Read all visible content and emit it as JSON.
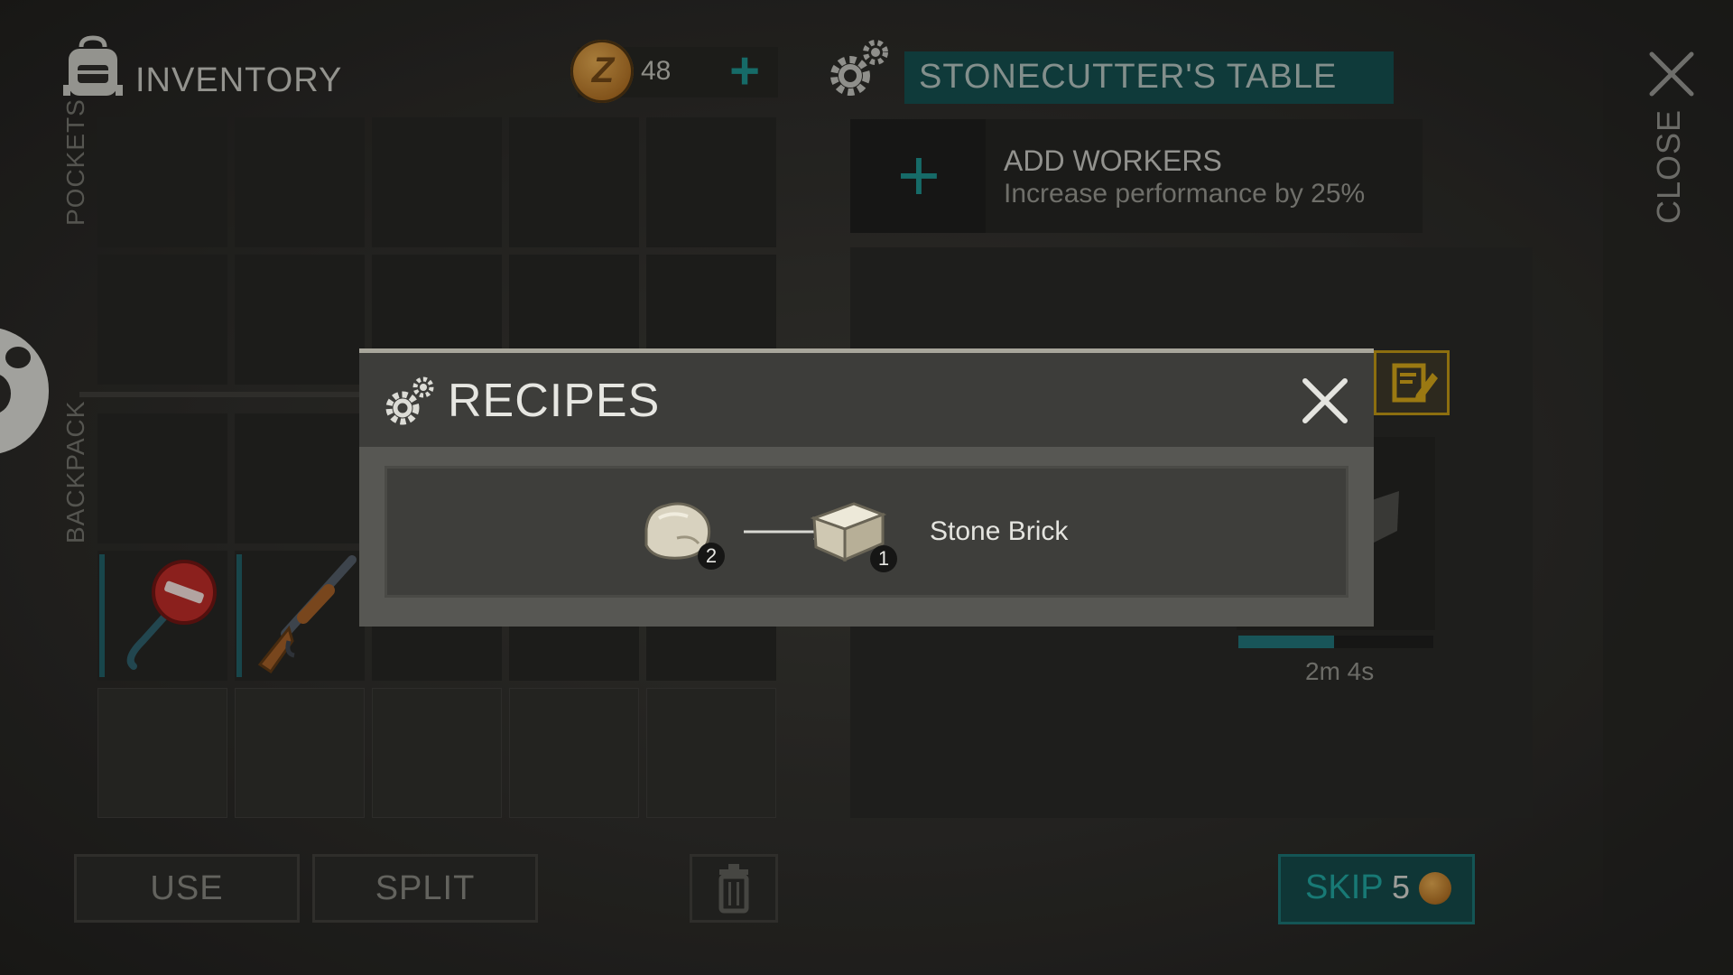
{
  "inventory": {
    "title": "INVENTORY",
    "pockets_label": "POCKETS",
    "backpack_label": "BACKPACK",
    "coins": "48",
    "coin_add": "+"
  },
  "station": {
    "title": "STONECUTTER'S TABLE",
    "workers_title": "ADD WORKERS",
    "workers_subtitle": "Increase performance by 25%",
    "workers_add": "+",
    "timer": "2m 4s",
    "close_label": "CLOSE"
  },
  "bottom": {
    "use_label": "USE",
    "split_label": "SPLIT",
    "skip_label": "SKIP",
    "skip_cost": "5"
  },
  "modal": {
    "title": "RECIPES",
    "recipes": [
      {
        "input_icon": "stone-icon",
        "input_count": "2",
        "output_icon": "stone-brick-icon",
        "output_count": "1",
        "name": "Stone Brick"
      }
    ]
  },
  "colors": {
    "accent_teal": "#1d8a86",
    "title_bar": "#144b4b",
    "coin_gold": "#c78a34",
    "note_border": "#b48e14"
  }
}
